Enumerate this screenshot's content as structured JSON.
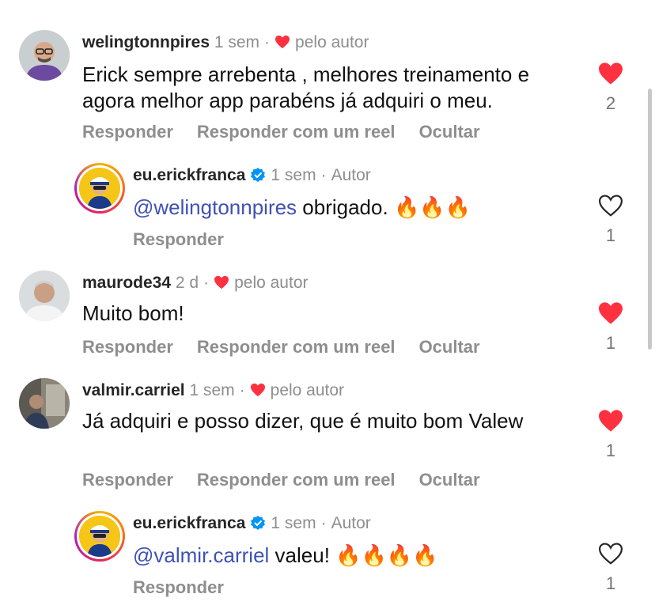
{
  "comments": [
    {
      "username": "welingtonnpires",
      "time": "1 sem",
      "liked_label": "pelo autor",
      "text": "Erick sempre arrebenta , melhores treinamento e agora melhor app parabéns já adquiri o meu.",
      "actions": [
        "Responder",
        "Responder com um reel",
        "Ocultar"
      ],
      "likes": "2",
      "liked": true
    },
    {
      "username": "eu.erickfranca",
      "time": "1 sem",
      "author_label": "Autor",
      "mention": "@welingtonnpires",
      "text": " obrigado. ",
      "emojis": "🔥🔥🔥",
      "actions": [
        "Responder"
      ],
      "likes": "1",
      "liked": false
    },
    {
      "username": "maurode34",
      "time": "2 d",
      "liked_label": "pelo autor",
      "text": "Muito bom!",
      "actions": [
        "Responder",
        "Responder com um reel",
        "Ocultar"
      ],
      "likes": "1",
      "liked": true
    },
    {
      "username": "valmir.carriel",
      "time": "1 sem",
      "liked_label": "pelo autor",
      "text": "Já adquiri e posso dizer, que é muito bom Valew",
      "actions": [
        "Responder",
        "Responder com um reel",
        "Ocultar"
      ],
      "likes": "1",
      "liked": true
    },
    {
      "username": "eu.erickfranca",
      "time": "1 sem",
      "author_label": "Autor",
      "mention": "@valmir.carriel",
      "text": " valeu! ",
      "emojis": "🔥🔥🔥🔥",
      "actions": [
        "Responder"
      ],
      "likes": "1",
      "liked": false
    }
  ],
  "colors": {
    "like_red": "#ff3040",
    "mention_blue": "#3f51b5",
    "verified_blue": "#0095f6",
    "muted_gray": "#8e8e8e"
  },
  "icons": [
    "heart-filled-icon",
    "heart-outline-icon",
    "verified-badge-icon",
    "fire-emoji"
  ]
}
